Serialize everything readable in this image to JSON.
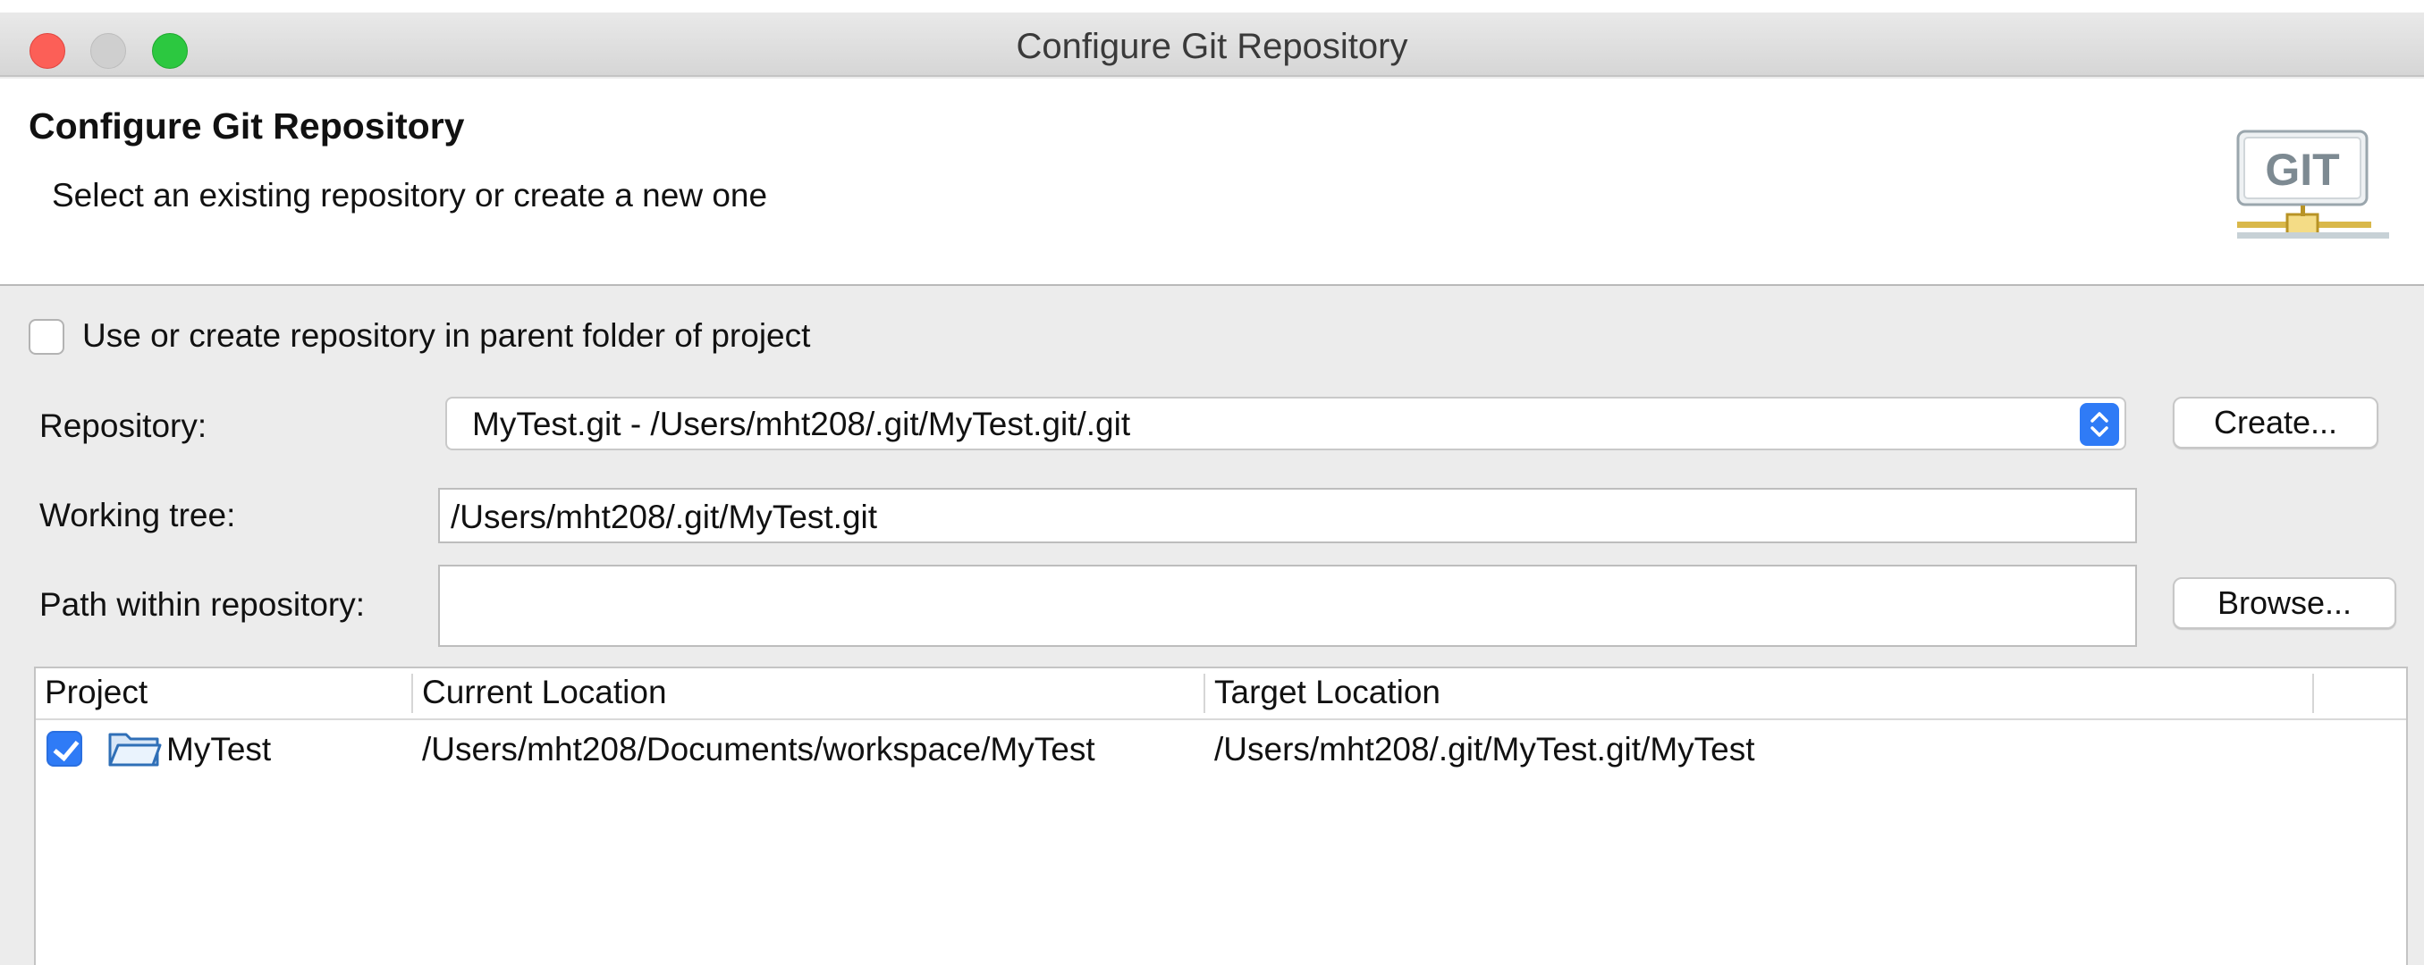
{
  "window": {
    "title": "Configure Git Repository"
  },
  "banner": {
    "title": "Configure Git Repository",
    "subtitle": "Select an existing repository or create a new one",
    "logo_text": "GIT",
    "logo_icon": "git-logo-icon"
  },
  "form": {
    "parent_folder_checkbox": {
      "label": "Use or create repository in parent folder of project",
      "checked": false
    },
    "repository": {
      "label": "Repository:",
      "value": "MyTest.git - /Users/mht208/.git/MyTest.git/.git"
    },
    "create_button": "Create...",
    "working_tree": {
      "label": "Working tree:",
      "value": "/Users/mht208/.git/MyTest.git"
    },
    "path_within_repository": {
      "label": "Path within repository:",
      "value": ""
    },
    "browse_button": "Browse..."
  },
  "table": {
    "columns": [
      "Project",
      "Current Location",
      "Target Location"
    ],
    "rows": [
      {
        "checked": true,
        "icon": "folder-icon",
        "project": "MyTest",
        "current_location": "/Users/mht208/Documents/workspace/MyTest",
        "target_location": "/Users/mht208/.git/MyTest.git/MyTest"
      }
    ]
  },
  "colors": {
    "accent": "#2f7bf6",
    "close": "#fc5f57",
    "zoom": "#2cc840"
  }
}
